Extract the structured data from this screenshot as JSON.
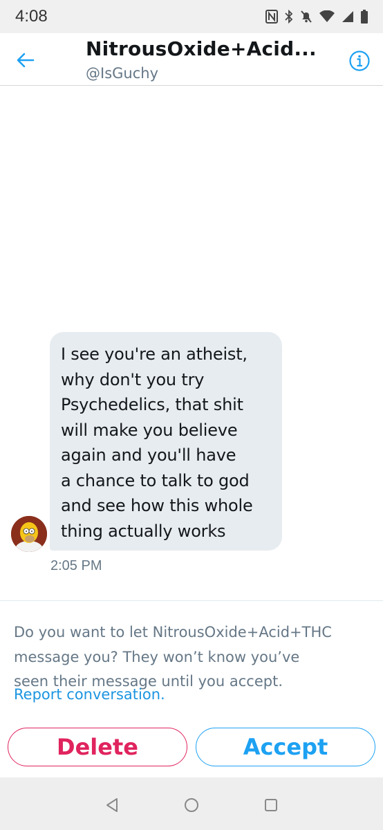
{
  "status_bar": {
    "time": "4:08",
    "icons": [
      "nfc-icon",
      "bluetooth-icon",
      "mute-icon",
      "wifi-icon",
      "signal-icon",
      "battery-icon"
    ]
  },
  "header": {
    "title": "NitrousOxide+Acid...",
    "handle": "@IsGuchy",
    "back_icon": "back-arrow-icon",
    "info_icon": "info-icon"
  },
  "conversation": {
    "messages": [
      {
        "lines": [
          "I see you're an atheist,",
          "why don't you try",
          "Psychedelics, that shit",
          "will make you believe",
          "again and you'll have",
          "a chance to talk to god",
          "and see how this whole",
          "thing actually works"
        ],
        "time": "2:05 PM"
      }
    ]
  },
  "request": {
    "lines": [
      "Do you want to let NitrousOxide+Acid+THC",
      "message you? They won’t know you’ve",
      "seen their message until you accept."
    ],
    "report_link": "Report conversation."
  },
  "actions": {
    "delete_label": "Delete",
    "accept_label": "Accept"
  },
  "colors": {
    "accent": "#1da1f2",
    "delete": "#e0245e",
    "bubble": "#e6ecf0",
    "secondary_text": "#657786"
  }
}
